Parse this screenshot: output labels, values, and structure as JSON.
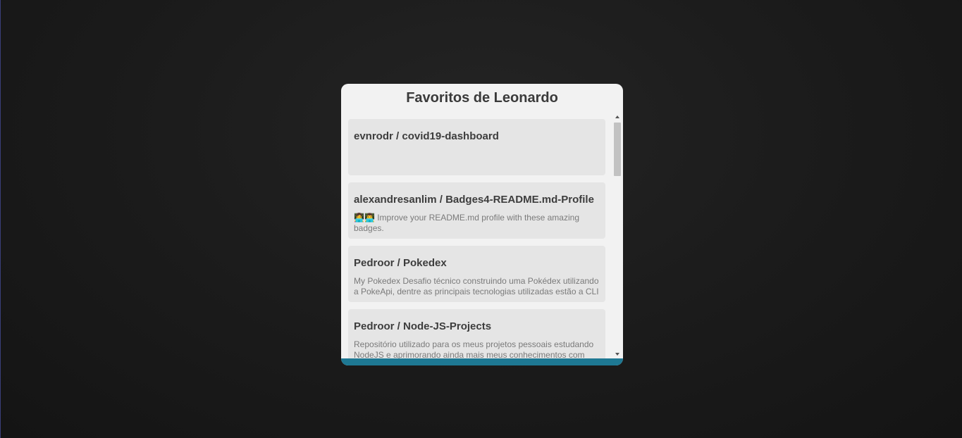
{
  "modal": {
    "title": "Favoritos de Leonardo",
    "accent_color": "#1e7893"
  },
  "favorites": [
    {
      "title": "evnrodr / covid19-dashboard",
      "description": ""
    },
    {
      "title": "alexandresanlim / Badges4-README.md-Profile",
      "description": "👩‍💻👨‍💻 Improve your README.md profile with these amazing badges."
    },
    {
      "title": "Pedroor / Pokedex",
      "description": "My Pokedex Desafio técnico construindo uma Pokédex utilizando a PokeApi, dentre as principais tecnologias utilizadas estão a CLI"
    },
    {
      "title": "Pedroor / Node-JS-Projects",
      "description": "Repositório utilizado para os meus projetos pessoais estudando NodeJS e aprimorando ainda mais meus conhecimentos com"
    }
  ],
  "scrollbar": {
    "up_icon": "triangle-up-icon",
    "down_icon": "triangle-down-icon"
  }
}
